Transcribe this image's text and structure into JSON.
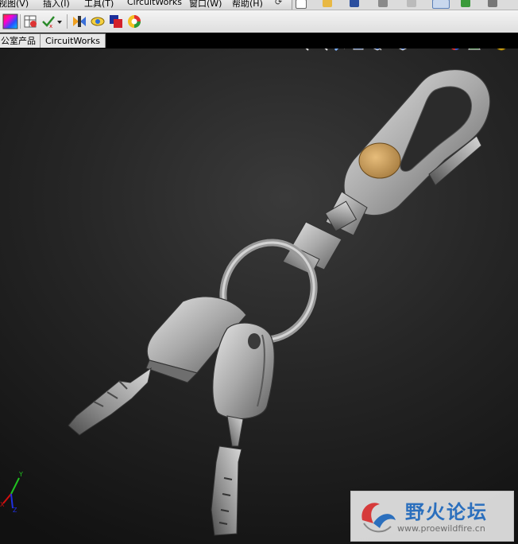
{
  "menu": {
    "items": [
      "视图(V)",
      "插入(I)",
      "工具(T)",
      "CircuitWorks",
      "窗口(W)",
      "帮助(H)"
    ]
  },
  "tabs": [
    "公室产品",
    "CircuitWorks"
  ],
  "toolbar_icons": [
    "color-swatch-icon",
    "sketch-table-icon",
    "check-tool-icon",
    "dropdown-arrow-icon",
    "weld-bead-icon",
    "appearance-eye-icon",
    "layer-icon",
    "color-wheel-icon"
  ],
  "headsup_icons": [
    "zoom-to-fit-icon",
    "zoom-area-icon",
    "section-view-icon",
    "view-orientation-icon",
    "display-style-icon",
    "hide-show-icon",
    "edit-appearance-icon",
    "apply-scene-icon",
    "view-settings-icon"
  ],
  "triad": {
    "x": "X",
    "y": "Y",
    "z": "Z"
  },
  "watermark": {
    "title": "野火论坛",
    "url": "www.proewildfire.cn"
  },
  "colors": {
    "viewport_bg": "#262626",
    "tab_bg": "#e6e6e6",
    "metal": "#a8a8a8",
    "gold_badge": "#c9a063",
    "watermark_text": "#2b6fbd"
  }
}
